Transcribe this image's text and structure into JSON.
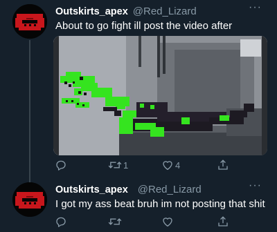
{
  "tweets": [
    {
      "display_name": "Outskirts_apex",
      "handle": "@Red_Lizard",
      "text": "About to go fight ill post the video after",
      "retweets": "1",
      "likes": "4",
      "more_label": "···"
    },
    {
      "display_name": "Outskirts_apex",
      "handle": "@Red_Lizard",
      "text": "I got my ass beat bruh im not posting that shit",
      "retweets": "",
      "likes": "",
      "more_label": "···"
    }
  ],
  "colors": {
    "background": "#15202b",
    "secondary_text": "#8899a6",
    "thread_line": "#38444d",
    "lizard_green": "#35e41f",
    "avatar_red": "#c8161c"
  },
  "icons": [
    "reply-icon",
    "retweet-icon",
    "like-icon",
    "share-icon",
    "more-icon"
  ]
}
